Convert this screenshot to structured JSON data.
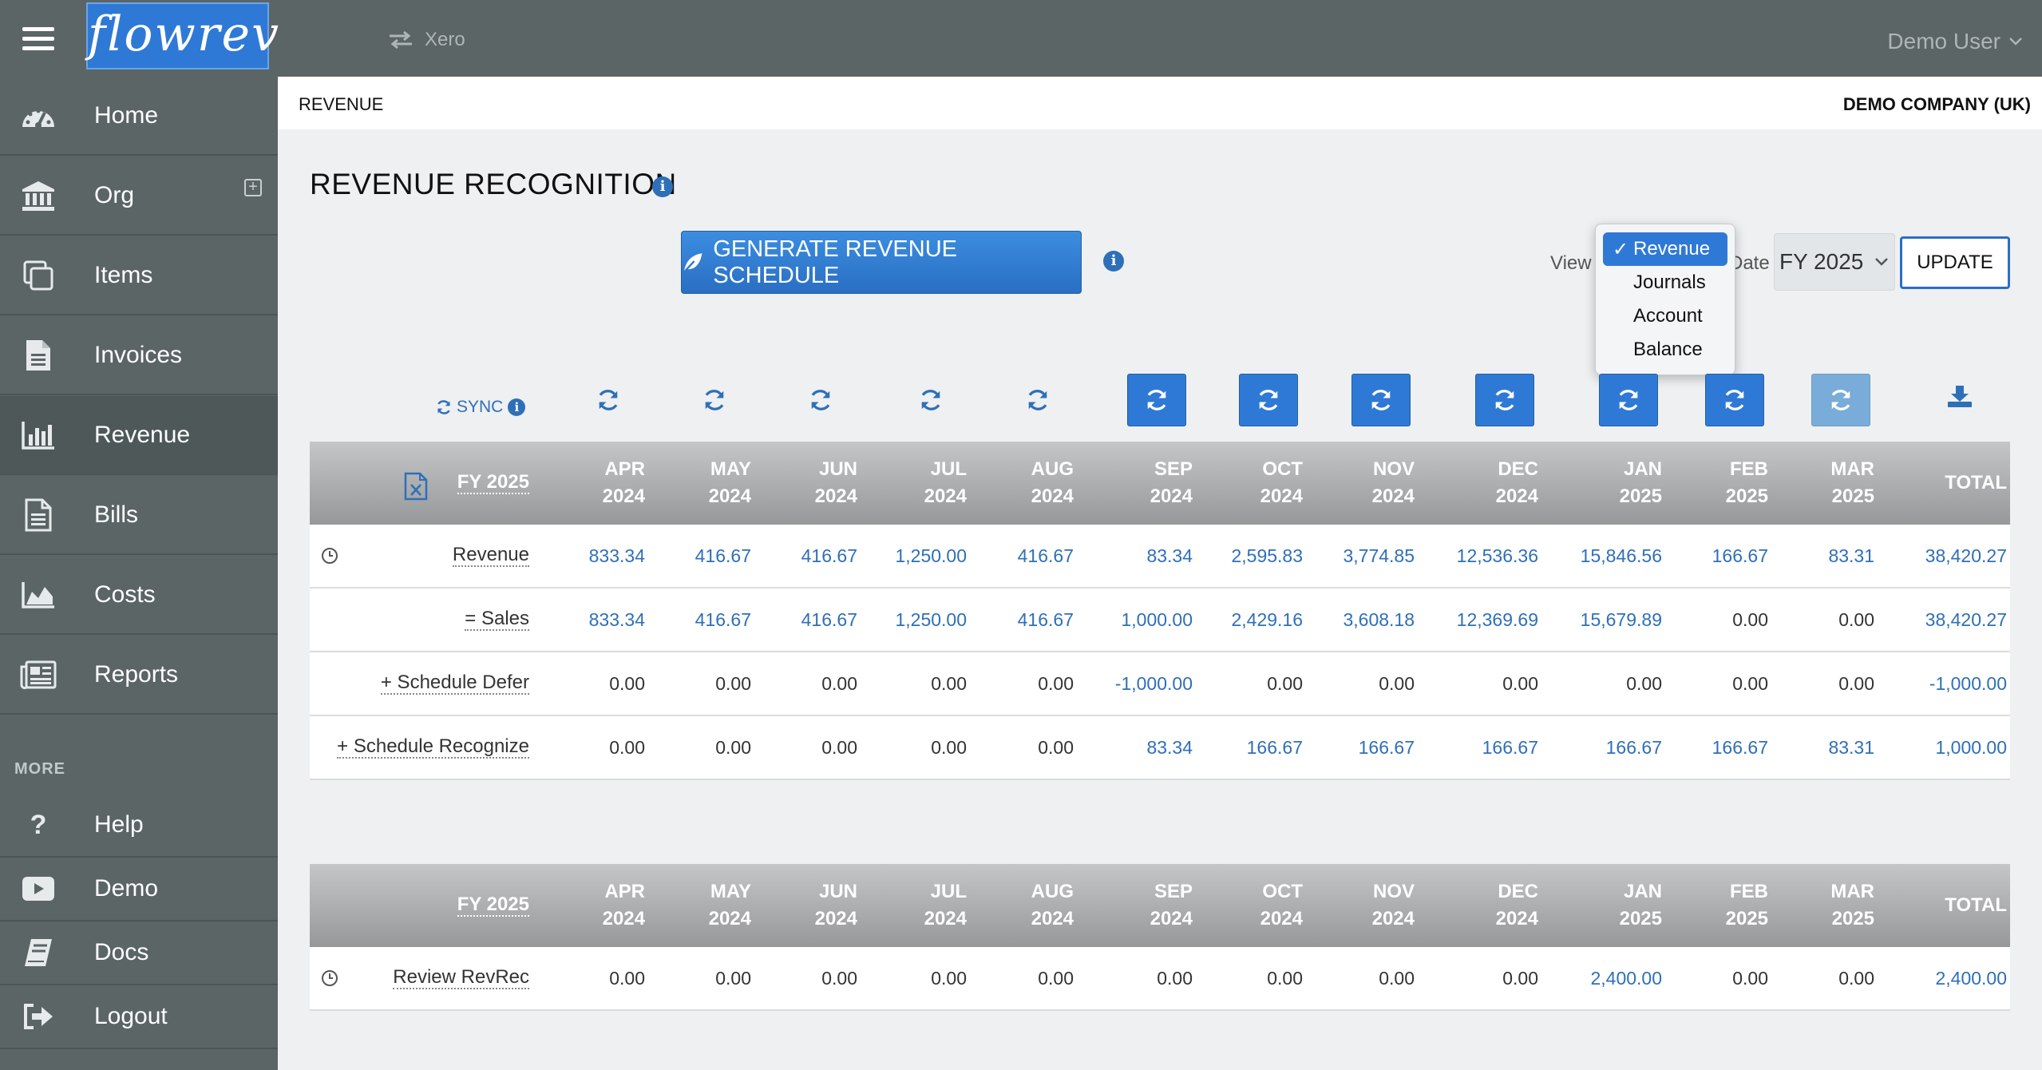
{
  "app": {
    "logo_text": "flowrev",
    "integration": "Xero",
    "user": "Demo User"
  },
  "sidebar": {
    "items": [
      {
        "label": "Home",
        "icon": "dashboard-icon"
      },
      {
        "label": "Org",
        "icon": "bank-icon"
      },
      {
        "label": "Items",
        "icon": "copy-icon"
      },
      {
        "label": "Invoices",
        "icon": "document-icon"
      },
      {
        "label": "Revenue",
        "icon": "bar-chart-icon",
        "active": true
      },
      {
        "label": "Bills",
        "icon": "file-lines-icon"
      },
      {
        "label": "Costs",
        "icon": "area-chart-icon"
      },
      {
        "label": "Reports",
        "icon": "newspaper-icon"
      }
    ],
    "more_label": "MORE",
    "more_items": [
      {
        "label": "Help",
        "icon": "question-icon"
      },
      {
        "label": "Demo",
        "icon": "play-icon"
      },
      {
        "label": "Docs",
        "icon": "book-icon"
      },
      {
        "label": "Logout",
        "icon": "sign-out-icon"
      }
    ]
  },
  "header": {
    "breadcrumb": "REVENUE",
    "company": "DEMO COMPANY (UK)"
  },
  "main": {
    "title": "REVENUE RECOGNITION",
    "generate_button": "GENERATE REVENUE SCHEDULE",
    "view_label": "View",
    "date_label": "Date",
    "date_value": "FY 2025",
    "update_button": "UPDATE",
    "view_options": [
      "Revenue",
      "Journals",
      "Account",
      "Balance"
    ],
    "view_selected": "Revenue",
    "sync_label": "SYNC",
    "fy_label": "FY 2025",
    "accent_color": "#2f79d6"
  },
  "columns": [
    [
      "APR",
      "2024"
    ],
    [
      "MAY",
      "2024"
    ],
    [
      "JUN",
      "2024"
    ],
    [
      "JUL",
      "2024"
    ],
    [
      "AUG",
      "2024"
    ],
    [
      "SEP",
      "2024"
    ],
    [
      "OCT",
      "2024"
    ],
    [
      "NOV",
      "2024"
    ],
    [
      "DEC",
      "2024"
    ],
    [
      "JAN",
      "2025"
    ],
    [
      "FEB",
      "2025"
    ],
    [
      "MAR",
      "2025"
    ],
    [
      "TOTAL",
      ""
    ]
  ],
  "sync_buttons": [
    "plain",
    "plain",
    "plain",
    "plain",
    "plain",
    "filled",
    "filled",
    "filled",
    "filled",
    "filled",
    "filled",
    "pale"
  ],
  "table1": {
    "rows": [
      {
        "label": "Revenue",
        "clock": true,
        "values": [
          "833.34",
          "416.67",
          "416.67",
          "1,250.00",
          "416.67",
          "83.34",
          "2,595.83",
          "3,774.85",
          "12,536.36",
          "15,846.56",
          "166.67",
          "83.31",
          "38,420.27"
        ]
      },
      {
        "label": "= Sales",
        "clock": false,
        "values": [
          "833.34",
          "416.67",
          "416.67",
          "1,250.00",
          "416.67",
          "1,000.00",
          "2,429.16",
          "3,608.18",
          "12,369.69",
          "15,679.89",
          "0.00",
          "0.00",
          "38,420.27"
        ]
      },
      {
        "label": "+ Schedule Defer",
        "clock": false,
        "values": [
          "0.00",
          "0.00",
          "0.00",
          "0.00",
          "0.00",
          "-1,000.00",
          "0.00",
          "0.00",
          "0.00",
          "0.00",
          "0.00",
          "0.00",
          "-1,000.00"
        ]
      },
      {
        "label": "+ Schedule Recognize",
        "clock": false,
        "values": [
          "0.00",
          "0.00",
          "0.00",
          "0.00",
          "0.00",
          "83.34",
          "166.67",
          "166.67",
          "166.67",
          "166.67",
          "166.67",
          "83.31",
          "1,000.00"
        ]
      }
    ]
  },
  "table2": {
    "rows": [
      {
        "label": "Review RevRec",
        "clock": true,
        "values": [
          "0.00",
          "0.00",
          "0.00",
          "0.00",
          "0.00",
          "0.00",
          "0.00",
          "0.00",
          "0.00",
          "2,400.00",
          "0.00",
          "0.00",
          "2,400.00"
        ]
      }
    ]
  }
}
